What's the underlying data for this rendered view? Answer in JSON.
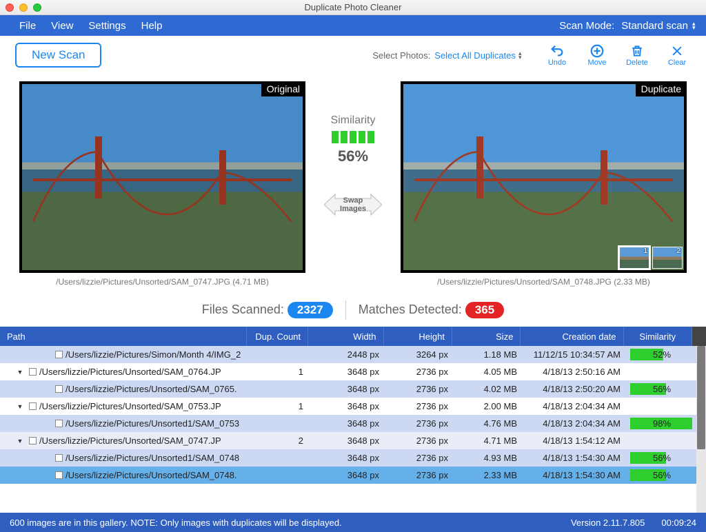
{
  "window": {
    "title": "Duplicate Photo Cleaner"
  },
  "menubar": {
    "items": [
      "File",
      "View",
      "Settings",
      "Help"
    ],
    "scan_mode_label": "Scan Mode:",
    "scan_mode_value": "Standard scan"
  },
  "toolbar": {
    "new_scan": "New Scan",
    "select_photos_label": "Select Photos:",
    "select_photos_link": "Select All Duplicates",
    "actions": {
      "undo": {
        "label": "Undo"
      },
      "move": {
        "label": "Move"
      },
      "delete": {
        "label": "Delete"
      },
      "clear": {
        "label": "Clear"
      }
    }
  },
  "preview": {
    "similarity_label": "Similarity",
    "similarity_pct": "56%",
    "swap_label_1": "Swap",
    "swap_label_2": "Images",
    "left": {
      "badge": "Original",
      "caption": "/Users/lizzie/Pictures/Unsorted/SAM_0747.JPG (4.71 MB)"
    },
    "right": {
      "badge": "Duplicate",
      "caption": "/Users/lizzie/Pictures/Unsorted/SAM_0748.JPG (2.33 MB)",
      "thumbs": [
        "1",
        "2"
      ]
    }
  },
  "counts": {
    "files_scanned_label": "Files Scanned:",
    "files_scanned_value": "2327",
    "matches_label": "Matches Detected:",
    "matches_value": "365"
  },
  "table": {
    "headers": {
      "path": "Path",
      "dup": "Dup. Count",
      "width": "Width",
      "height": "Height",
      "size": "Size",
      "date": "Creation date",
      "sim": "Similarity"
    },
    "rows": [
      {
        "kind": "child",
        "indent": 38,
        "path": "/Users/lizzie/Pictures/Simon/Month 4/IMG_2",
        "dup": "",
        "w": "2448 px",
        "h": "3264 px",
        "size": "1.18 MB",
        "date": "11/12/15 10:34:57 AM",
        "sim": "52%",
        "simw": 52,
        "alt": false
      },
      {
        "kind": "parent",
        "indent": 0,
        "path": "/Users/lizzie/Pictures/Unsorted/SAM_0764.JP",
        "dup": "1",
        "w": "3648 px",
        "h": "2736 px",
        "size": "4.05 MB",
        "date": "4/18/13 2:50:16 AM",
        "sim": "",
        "simw": 0,
        "alt": false
      },
      {
        "kind": "child",
        "indent": 38,
        "path": "/Users/lizzie/Pictures/Unsorted/SAM_0765.",
        "dup": "",
        "w": "3648 px",
        "h": "2736 px",
        "size": "4.02 MB",
        "date": "4/18/13 2:50:20 AM",
        "sim": "56%",
        "simw": 56,
        "alt": false
      },
      {
        "kind": "parent",
        "indent": 0,
        "path": "/Users/lizzie/Pictures/Unsorted/SAM_0753.JP",
        "dup": "1",
        "w": "3648 px",
        "h": "2736 px",
        "size": "2.00 MB",
        "date": "4/18/13 2:04:34 AM",
        "sim": "",
        "simw": 0,
        "alt": false
      },
      {
        "kind": "child",
        "indent": 38,
        "path": "/Users/lizzie/Pictures/Unsorted1/SAM_0753",
        "dup": "",
        "w": "3648 px",
        "h": "2736 px",
        "size": "4.76 MB",
        "date": "4/18/13 2:04:34 AM",
        "sim": "98%",
        "simw": 98,
        "alt": false
      },
      {
        "kind": "parent",
        "indent": 0,
        "path": "/Users/lizzie/Pictures/Unsorted/SAM_0747.JP",
        "dup": "2",
        "w": "3648 px",
        "h": "2736 px",
        "size": "4.71 MB",
        "date": "4/18/13 1:54:12 AM",
        "sim": "",
        "simw": 0,
        "alt": true
      },
      {
        "kind": "child",
        "indent": 38,
        "path": "/Users/lizzie/Pictures/Unsorted1/SAM_0748",
        "dup": "",
        "w": "3648 px",
        "h": "2736 px",
        "size": "4.93 MB",
        "date": "4/18/13 1:54:30 AM",
        "sim": "56%",
        "simw": 56,
        "alt": false
      },
      {
        "kind": "child",
        "indent": 38,
        "selected": true,
        "path": "/Users/lizzie/Pictures/Unsorted/SAM_0748.",
        "dup": "",
        "w": "3648 px",
        "h": "2736 px",
        "size": "2.33 MB",
        "date": "4/18/13 1:54:30 AM",
        "sim": "56%",
        "simw": 56,
        "alt": false
      }
    ]
  },
  "statusbar": {
    "msg": "600 images are in this gallery. NOTE: Only images with duplicates will be displayed.",
    "version": "Version 2.11.7.805",
    "time": "00:09:24"
  }
}
